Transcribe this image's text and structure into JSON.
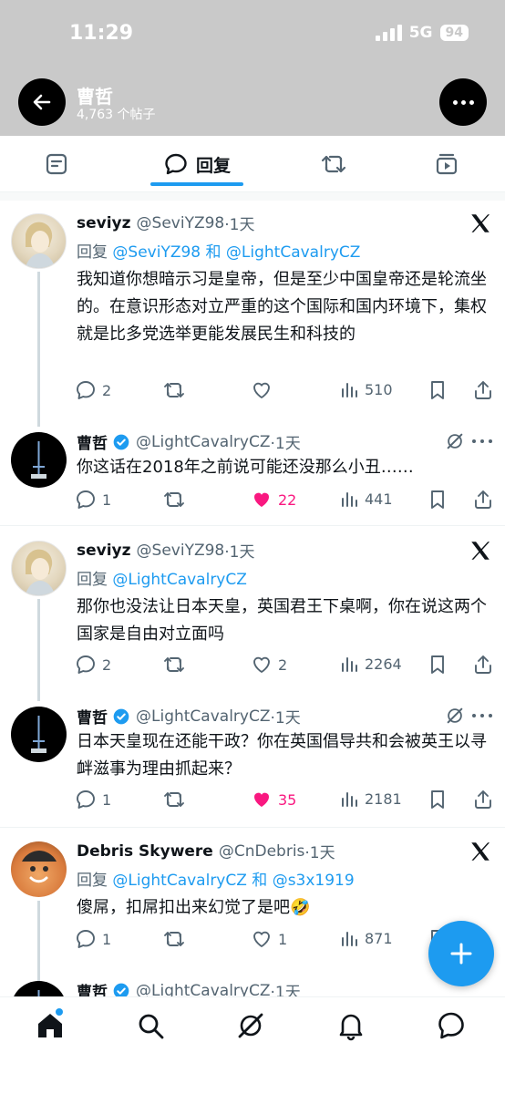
{
  "status_bar": {
    "time": "11:29",
    "network": "5G",
    "battery": "94"
  },
  "profile": {
    "name": "曹哲",
    "post_count": "4,763 个帖子"
  },
  "tabs": [
    {
      "label": ""
    },
    {
      "label": "回复",
      "icon": "speech-bubble-icon",
      "active": true
    },
    {
      "label": ""
    },
    {
      "label": ""
    }
  ],
  "replies": [
    {
      "name": "seviyz",
      "handle": "@SeviYZ98",
      "time": "·1天",
      "verified": false,
      "reply_prefix": "回复 ",
      "mentions": "@SeviYZ98 和 @LightCavalryCZ",
      "text": "我知道你想暗示习是皇帝，但是至少中国皇帝还是轮流坐的。在意识形态对立严重的这个国际和国内环境下，集权就是比多党选举更能发展民生和科技的",
      "replies": "2",
      "retweets": "",
      "likes": "",
      "views": "510",
      "liked": false
    },
    {
      "name": "曹哲",
      "handle": "@LightCavalryCZ",
      "time": "·1天",
      "verified": true,
      "text": "你这话在2018年之前说可能还没那么小丑……",
      "replies": "1",
      "retweets": "",
      "likes": "22",
      "views": "441",
      "liked": true
    },
    {
      "name": "seviyz",
      "handle": "@SeviYZ98",
      "time": "·1天",
      "verified": false,
      "reply_prefix": "回复 ",
      "mentions": "@LightCavalryCZ",
      "text": "那你也没法让日本天皇，英国君王下桌啊，你在说这两个国家是自由对立面吗",
      "replies": "2",
      "retweets": "",
      "likes": "2",
      "views": "2264",
      "liked": false
    },
    {
      "name": "曹哲",
      "handle": "@LightCavalryCZ",
      "time": "·1天",
      "verified": true,
      "text": "日本天皇现在还能干政？你在英国倡导共和会被英王以寻衅滋事为理由抓起来？",
      "replies": "1",
      "retweets": "",
      "likes": "35",
      "views": "2181",
      "liked": true
    },
    {
      "name": "Debris Skywere",
      "handle": "@CnDebris",
      "time": "·1天",
      "verified": false,
      "reply_prefix": "回复 ",
      "mentions": "@LightCavalryCZ 和 @s3x1919",
      "text": "傻屌，扣屌扣出来幻觉了是吧🤣",
      "replies": "1",
      "retweets": "",
      "likes": "1",
      "views": "871",
      "liked": false
    },
    {
      "name": "曹哲",
      "handle": "@LightCavalryCZ",
      "time": "·1天",
      "verified": true
    }
  ],
  "colors": {
    "accent": "#1d9bf0",
    "like": "#f91880",
    "header_bg": "#c9c9c9",
    "secondary_text": "#536471"
  }
}
